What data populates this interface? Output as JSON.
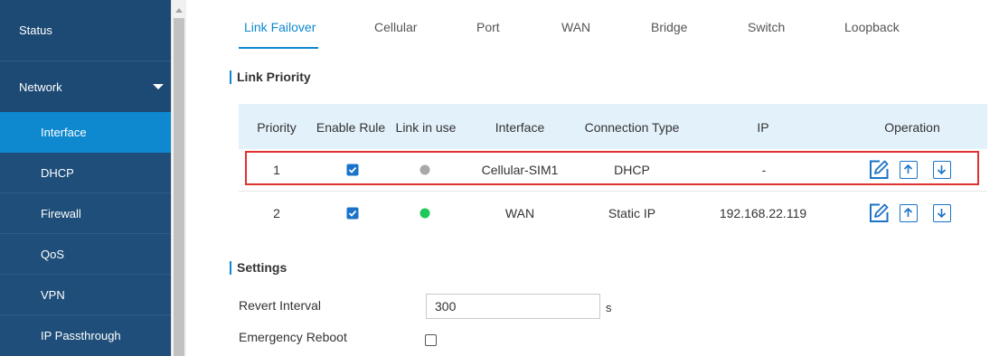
{
  "sidebar": {
    "items": [
      {
        "label": "Status"
      },
      {
        "label": "Network"
      },
      {
        "label": "Interface"
      },
      {
        "label": "DHCP"
      },
      {
        "label": "Firewall"
      },
      {
        "label": "QoS"
      },
      {
        "label": "VPN"
      },
      {
        "label": "IP Passthrough"
      }
    ],
    "active_item": "Interface"
  },
  "tabs": [
    {
      "label": "Link Failover",
      "active": true
    },
    {
      "label": "Cellular"
    },
    {
      "label": "Port"
    },
    {
      "label": "WAN"
    },
    {
      "label": "Bridge"
    },
    {
      "label": "Switch"
    },
    {
      "label": "Loopback"
    }
  ],
  "link_priority": {
    "title": "Link Priority",
    "columns": [
      "Priority",
      "Enable Rule",
      "Link in use",
      "Interface",
      "Connection Type",
      "IP",
      "Operation"
    ],
    "rows": [
      {
        "priority": "1",
        "enable_rule": true,
        "link_in_use": "inactive",
        "interface": "Cellular-SIM1",
        "connection_type": "DHCP",
        "ip": "-",
        "highlighted": true
      },
      {
        "priority": "2",
        "enable_rule": true,
        "link_in_use": "active",
        "interface": "WAN",
        "connection_type": "Static IP",
        "ip": "192.168.22.119",
        "highlighted": false
      }
    ],
    "operation_icons": [
      "edit-icon",
      "arrow-up-icon",
      "arrow-down-icon"
    ]
  },
  "settings": {
    "title": "Settings",
    "revert_interval": {
      "label": "Revert Interval",
      "value": "300",
      "unit": "s"
    },
    "emergency_reboot": {
      "label": "Emergency Reboot",
      "checked": false
    }
  },
  "colors": {
    "sidebar_bg": "#1e4e79",
    "sidebar_active": "#0e88cf",
    "accent": "#0e88cf",
    "table_header_bg": "#e3f1fb",
    "highlight_border": "#e0322e",
    "link_active": "#1ec85a",
    "link_inactive": "#a8a8a8",
    "checkbox": "#1a73c9"
  }
}
